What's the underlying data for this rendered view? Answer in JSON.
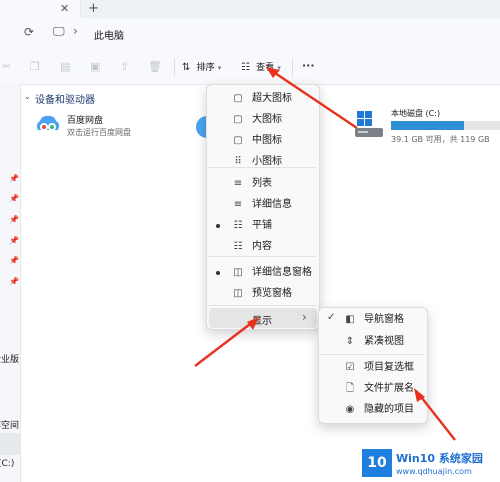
{
  "tab_icons": {
    "close": "✕",
    "new_tab": "+"
  },
  "nav": {
    "refresh_icon": "⟳",
    "monitor_icon": "🖵",
    "chevron": "›",
    "location": "此电脑"
  },
  "toolbar": {
    "sort_label": "排序",
    "view_label": "查看",
    "more": "···"
  },
  "section_title": "设备和驱动器",
  "baidu": {
    "name": "百度网盘",
    "sub": "双击运行百度网盘"
  },
  "drive": {
    "name": "本地磁盘 (C:)",
    "space": "39.1 GB 可用，共 119 GB",
    "used_fraction": 0.67
  },
  "left_pane_fragments": {
    "a": "企业版",
    "b": "非空间",
    "c": "(C:)"
  },
  "view_menu": [
    {
      "label": "超大图标",
      "icon": "▢",
      "checked": false
    },
    {
      "label": "大图标",
      "icon": "▢",
      "checked": false
    },
    {
      "label": "中图标",
      "icon": "▢",
      "checked": false
    },
    {
      "label": "小图标",
      "icon": "⠿",
      "checked": false
    },
    {
      "label": "列表",
      "icon": "≡",
      "checked": false
    },
    {
      "label": "详细信息",
      "icon": "≡",
      "checked": false
    },
    {
      "label": "平铺",
      "icon": "☷",
      "checked": true
    },
    {
      "label": "内容",
      "icon": "☷",
      "checked": false
    },
    {
      "label": "详细信息窗格",
      "icon": "◫",
      "checked": true
    },
    {
      "label": "预览窗格",
      "icon": "◫",
      "checked": false
    }
  ],
  "show_item": {
    "label": "显示",
    "arrow": "›"
  },
  "show_submenu": [
    {
      "label": "导航窗格",
      "icon": "◧",
      "checked": true
    },
    {
      "label": "紧凑视图",
      "icon": "⇕",
      "checked": false
    },
    {
      "label": "项目复选框",
      "icon": "☑",
      "checked": false
    },
    {
      "label": "文件扩展名",
      "icon": "🗋",
      "checked": false
    },
    {
      "label": "隐藏的项目",
      "icon": "◉",
      "checked": false
    }
  ],
  "watermark": {
    "logo": "Win10",
    "title": "Win10 系统家园",
    "url": "www.qdhuajin.com"
  }
}
